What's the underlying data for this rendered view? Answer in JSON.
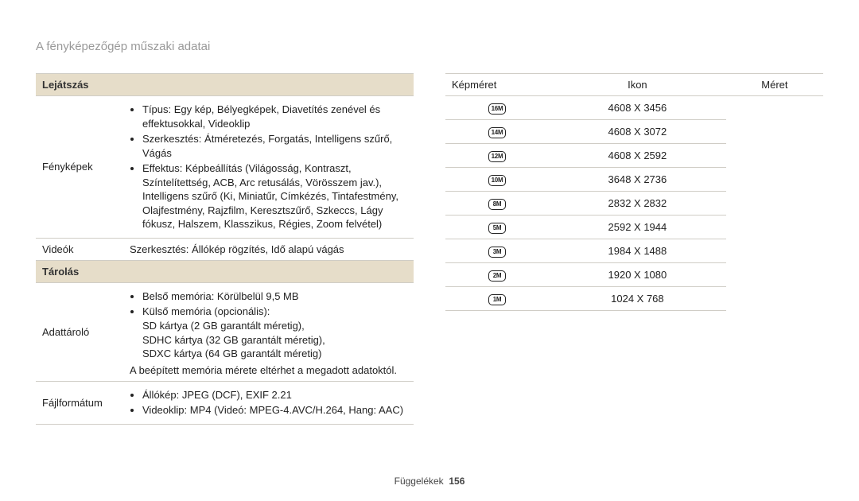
{
  "page_title": "A fényképezőgép műszaki adatai",
  "footer": {
    "section": "Függelékek",
    "page": "156"
  },
  "left": {
    "playback": {
      "header": "Lejátszás",
      "photos_label": "Fényképek",
      "photos_bullets": [
        "Típus: Egy kép, Bélyegképek, Diavetítés zenével és effektusokkal, Videoklip",
        "Szerkesztés: Átméretezés, Forgatás, Intelligens szűrő, Vágás",
        "Effektus: Képbeállítás (Világosság, Kontraszt, Színtelítettség, ACB, Arc retusálás, Vörösszem jav.), Intelligens szűrő (Ki, Miniatűr, Címkézés, Tintafestmény, Olajfestmény, Rajzfilm, Keresztszűrő, Szkeccs, Lágy fókusz, Halszem, Klasszikus, Régies, Zoom felvétel)"
      ],
      "videos_label": "Videók",
      "videos_value": "Szerkesztés: Állókép rögzítés, Idő alapú vágás"
    },
    "storage": {
      "header": "Tárolás",
      "media_label": "Adattároló",
      "media_bullets": [
        "Belső memória: Körülbelül 9,5 MB",
        "Külső memória (opcionális):\nSD kártya (2 GB garantált méretig),\nSDHC kártya (32 GB garantált méretig),\nSDXC kártya (64 GB garantált méretig)"
      ],
      "media_note": "A beépített memória mérete eltérhet a megadott adatoktól.",
      "format_label": "Fájlformátum",
      "format_bullets": [
        "Állókép: JPEG (DCF), EXIF 2.21",
        "Videoklip: MP4 (Videó: MPEG-4.AVC/H.264, Hang: AAC)"
      ]
    }
  },
  "right": {
    "rowlabel": "Képméret",
    "headers": {
      "icon": "Ikon",
      "size": "Méret"
    },
    "rows": [
      {
        "icon": "16M",
        "size": "4608 X 3456"
      },
      {
        "icon": "14M",
        "size": "4608 X 3072"
      },
      {
        "icon": "12M",
        "size": "4608 X 2592"
      },
      {
        "icon": "10M",
        "size": "3648 X 2736"
      },
      {
        "icon": "8M",
        "size": "2832 X 2832"
      },
      {
        "icon": "5M",
        "size": "2592 X 1944"
      },
      {
        "icon": "3M",
        "size": "1984 X 1488"
      },
      {
        "icon": "2M",
        "size": "1920 X 1080"
      },
      {
        "icon": "1M",
        "size": "1024 X 768"
      }
    ]
  }
}
